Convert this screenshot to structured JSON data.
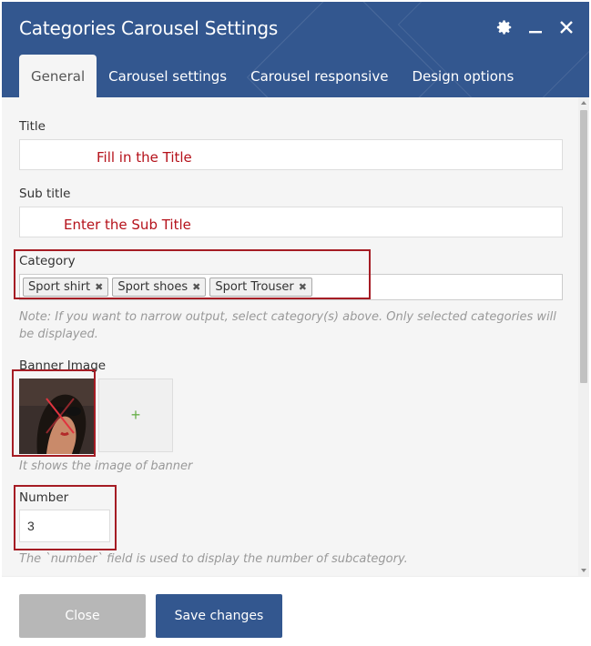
{
  "dialog": {
    "title": "Categories Carousel Settings",
    "tabs": [
      {
        "label": "General",
        "active": true
      },
      {
        "label": "Carousel settings",
        "active": false
      },
      {
        "label": "Carousel responsive",
        "active": false
      },
      {
        "label": "Design options",
        "active": false
      }
    ],
    "icons": {
      "settings": "gear-icon",
      "minimize": "minimize-icon",
      "close": "close-icon"
    }
  },
  "form": {
    "title": {
      "label": "Title",
      "hint": "Fill in the Title"
    },
    "subtitle": {
      "label": "Sub title",
      "hint": "Enter the Sub Title"
    },
    "category": {
      "label": "Category",
      "selected": [
        "Sport shirt",
        "Sport shoes",
        "Sport Trouser"
      ],
      "note": "Note: If you want to narrow output, select category(s) above. Only selected categories will be displayed."
    },
    "banner": {
      "label": "Banner Image",
      "add_symbol": "+",
      "help": "It shows the image of banner"
    },
    "number": {
      "label": "Number",
      "value": "3",
      "help": "The `number` field is used to display the number of subcategory."
    }
  },
  "footer": {
    "close_label": "Close",
    "save_label": "Save changes"
  },
  "colors": {
    "header": "#33578f",
    "annotation": "#a51c24",
    "hint_text": "#b5121b"
  }
}
